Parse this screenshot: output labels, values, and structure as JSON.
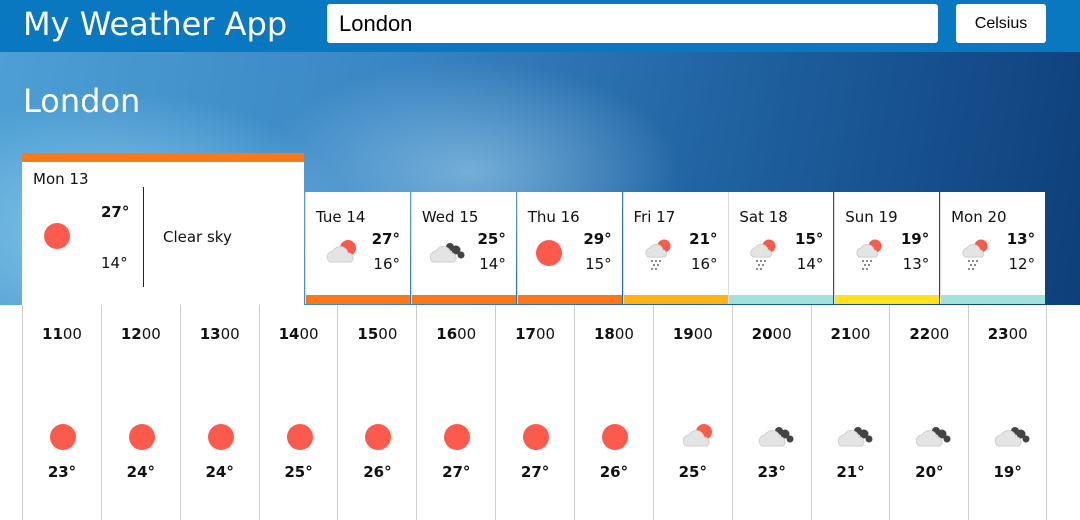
{
  "header": {
    "app_title": "My Weather App",
    "search_value": "London",
    "unit_label": "Celsius"
  },
  "city": "London",
  "colors": {
    "header_bg": "#0a78c0",
    "sun": "#fc5a4d",
    "orange": "#fa7818",
    "amber": "#ffb414",
    "teal": "#a2e2da",
    "yellow": "#ffe11e"
  },
  "selected_day": {
    "name": "Mon 13",
    "high": "27°",
    "low": "14°",
    "description": "Clear sky",
    "icon": "sun-icon",
    "bar_color": "#fa7818"
  },
  "days": [
    {
      "name": "Tue 14",
      "high": "27°",
      "low": "16°",
      "icon": "sun-cloud-icon",
      "bar_color": "#fa7818"
    },
    {
      "name": "Wed 15",
      "high": "25°",
      "low": "14°",
      "icon": "cloud-icon",
      "bar_color": "#fa7818"
    },
    {
      "name": "Thu 16",
      "high": "29°",
      "low": "15°",
      "icon": "sun-icon",
      "bar_color": "#fa7818"
    },
    {
      "name": "Fri 17",
      "high": "21°",
      "low": "16°",
      "icon": "rain-icon",
      "bar_color": "#ffb414"
    },
    {
      "name": "Sat 18",
      "high": "15°",
      "low": "14°",
      "icon": "rain-icon",
      "bar_color": "#a2e2da"
    },
    {
      "name": "Sun 19",
      "high": "19°",
      "low": "13°",
      "icon": "rain-icon",
      "bar_color": "#ffe11e"
    },
    {
      "name": "Mon 20",
      "high": "13°",
      "low": "12°",
      "icon": "rain-icon",
      "bar_color": "#a2e2da"
    }
  ],
  "hours": [
    {
      "hour": "11",
      "min": "00",
      "temp": "23°",
      "icon": "sun-icon"
    },
    {
      "hour": "12",
      "min": "00",
      "temp": "24°",
      "icon": "sun-icon"
    },
    {
      "hour": "13",
      "min": "00",
      "temp": "24°",
      "icon": "sun-icon"
    },
    {
      "hour": "14",
      "min": "00",
      "temp": "25°",
      "icon": "sun-icon"
    },
    {
      "hour": "15",
      "min": "00",
      "temp": "26°",
      "icon": "sun-icon"
    },
    {
      "hour": "16",
      "min": "00",
      "temp": "27°",
      "icon": "sun-icon"
    },
    {
      "hour": "17",
      "min": "00",
      "temp": "27°",
      "icon": "sun-icon"
    },
    {
      "hour": "18",
      "min": "00",
      "temp": "26°",
      "icon": "sun-icon"
    },
    {
      "hour": "19",
      "min": "00",
      "temp": "25°",
      "icon": "sun-cloud-icon"
    },
    {
      "hour": "20",
      "min": "00",
      "temp": "23°",
      "icon": "cloud-icon"
    },
    {
      "hour": "21",
      "min": "00",
      "temp": "21°",
      "icon": "cloud-icon"
    },
    {
      "hour": "22",
      "min": "00",
      "temp": "20°",
      "icon": "cloud-icon"
    },
    {
      "hour": "23",
      "min": "00",
      "temp": "19°",
      "icon": "cloud-icon"
    }
  ]
}
